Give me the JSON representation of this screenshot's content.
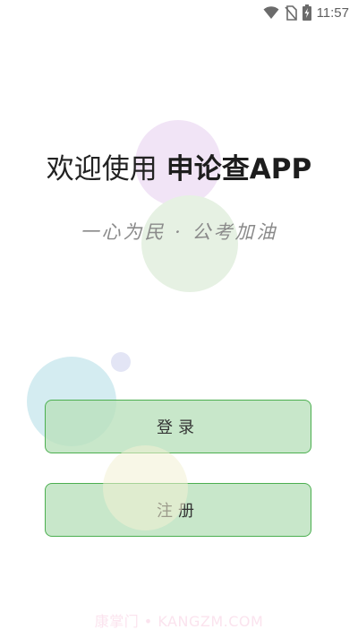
{
  "status_bar": {
    "time": "11:57",
    "icons": [
      "wifi-icon",
      "no-sim-icon",
      "battery-charging-icon"
    ]
  },
  "welcome": {
    "prefix": "欢迎使用",
    "app_name": "申论查APP"
  },
  "slogan": "一心为民 · 公考加油",
  "buttons": {
    "login_label": "登录",
    "register_label": "注册"
  },
  "watermark": "康掌门 • KANGZM.COM",
  "colors": {
    "button_fill": "#c8e6c9",
    "button_border": "#4caf50",
    "title_text": "#222222",
    "slogan_text": "#8a8a8a"
  }
}
